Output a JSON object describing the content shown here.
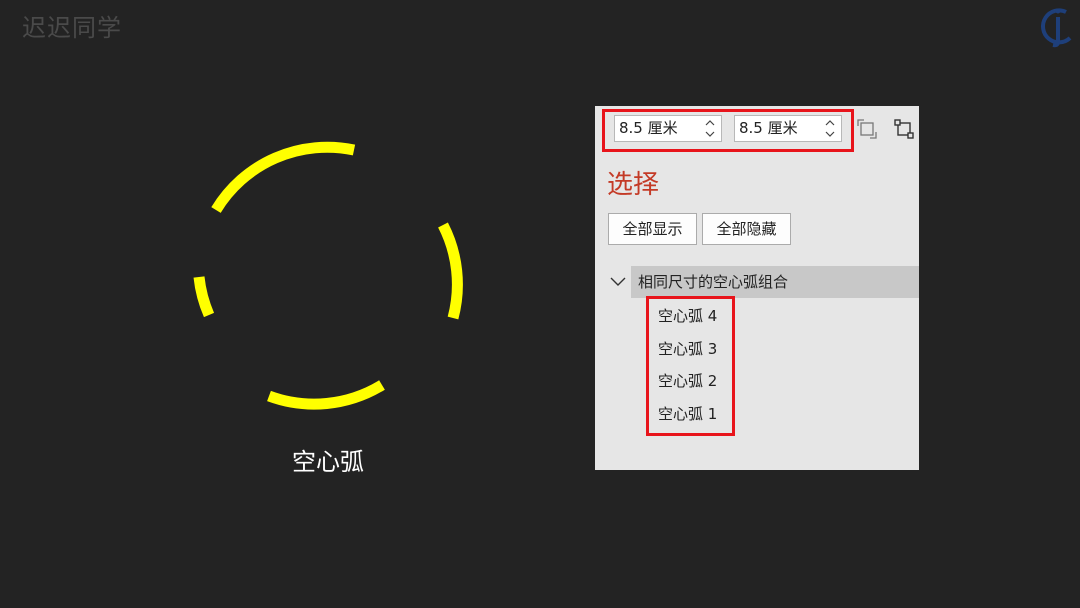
{
  "watermark": "迟迟同学",
  "logo_icon": "ic-monogram-logo",
  "canvas": {
    "caption": "空心弧",
    "arc_color": "#ffff00"
  },
  "panel": {
    "width_value": "8.5 厘米",
    "height_value": "8.5 厘米",
    "section_title": "选择",
    "show_all_label": "全部显示",
    "hide_all_label": "全部隐藏",
    "group_label": "相同尺寸的空心弧组合",
    "items": [
      "空心弧 4",
      "空心弧 3",
      "空心弧 2",
      "空心弧 1"
    ],
    "highlight_color": "#e8141b",
    "title_color": "#c43a26"
  }
}
